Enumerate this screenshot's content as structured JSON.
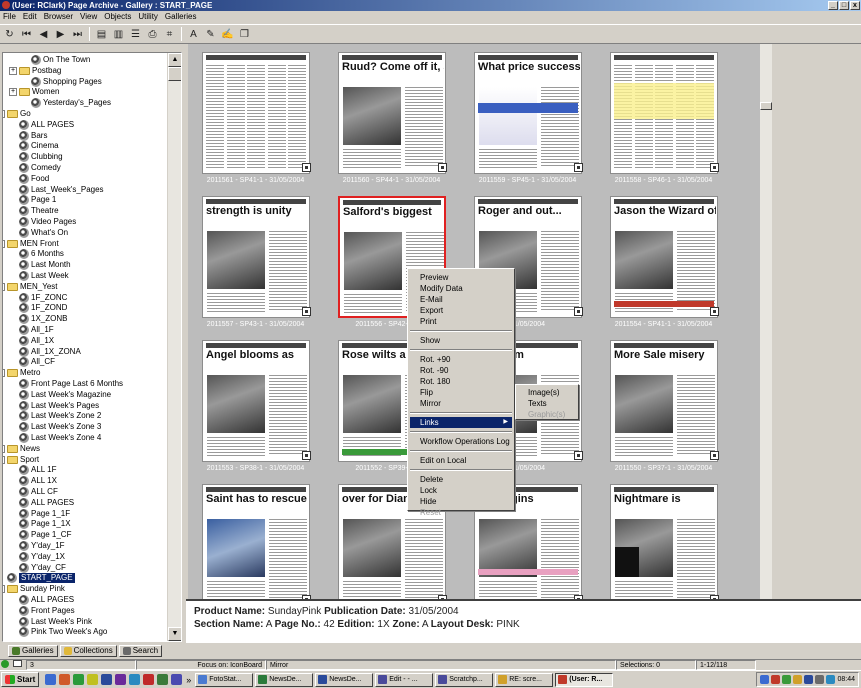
{
  "window": {
    "title": "(User: RClark) Page Archive - Gallery : START_PAGE",
    "buttons": [
      "_",
      "□",
      "x"
    ]
  },
  "menubar": [
    "File",
    "Edit",
    "Browser",
    "View",
    "Objects",
    "Utility",
    "Galleries"
  ],
  "toolbar": {
    "buttons": [
      {
        "icon": "refresh-icon",
        "glyph": "↻"
      },
      {
        "icon": "first-page-icon",
        "glyph": "⏮"
      },
      {
        "icon": "previous-icon",
        "glyph": "◀"
      },
      {
        "icon": "next-icon",
        "glyph": "▶"
      },
      {
        "icon": "last-page-icon",
        "glyph": "⏭"
      },
      {
        "icon": "preview-icon",
        "glyph": "▤"
      },
      {
        "icon": "document-icon",
        "glyph": "▥"
      },
      {
        "icon": "list-icon",
        "glyph": "☰"
      },
      {
        "icon": "print-icon",
        "glyph": "⎙"
      },
      {
        "icon": "binoculars-icon",
        "glyph": "⌗"
      },
      {
        "icon": "font-icon",
        "glyph": "A"
      },
      {
        "icon": "pen-icon",
        "glyph": "✎"
      },
      {
        "icon": "paint-icon",
        "glyph": "✍"
      },
      {
        "icon": "copy-icon",
        "glyph": "❐"
      }
    ]
  },
  "tree": [
    {
      "label": "On The Town",
      "level": 3,
      "type": "gallery"
    },
    {
      "label": "Postbag",
      "level": 2,
      "type": "folder",
      "expander": "+"
    },
    {
      "label": "Shopping Pages",
      "level": 3,
      "type": "gallery"
    },
    {
      "label": "Women",
      "level": 2,
      "type": "folder",
      "expander": "+"
    },
    {
      "label": "Yesterday's_Pages",
      "level": 3,
      "type": "gallery"
    },
    {
      "label": "Go",
      "level": 1,
      "type": "folder",
      "expander": "-"
    },
    {
      "label": "ALL PAGES",
      "level": 2,
      "type": "gallery"
    },
    {
      "label": "Bars",
      "level": 2,
      "type": "gallery"
    },
    {
      "label": "Cinema",
      "level": 2,
      "type": "gallery"
    },
    {
      "label": "Clubbing",
      "level": 2,
      "type": "gallery"
    },
    {
      "label": "Comedy",
      "level": 2,
      "type": "gallery"
    },
    {
      "label": "Food",
      "level": 2,
      "type": "gallery"
    },
    {
      "label": "Last_Week's_Pages",
      "level": 2,
      "type": "gallery"
    },
    {
      "label": "Page 1",
      "level": 2,
      "type": "gallery"
    },
    {
      "label": "Theatre",
      "level": 2,
      "type": "gallery"
    },
    {
      "label": "Video Pages",
      "level": 2,
      "type": "gallery"
    },
    {
      "label": "What's On",
      "level": 2,
      "type": "gallery"
    },
    {
      "label": "MEN Front",
      "level": 1,
      "type": "folder",
      "expander": "-"
    },
    {
      "label": "6 Months",
      "level": 2,
      "type": "gallery"
    },
    {
      "label": "Last Month",
      "level": 2,
      "type": "gallery"
    },
    {
      "label": "Last Week",
      "level": 2,
      "type": "gallery"
    },
    {
      "label": "MEN_Yest",
      "level": 1,
      "type": "folder",
      "expander": "-"
    },
    {
      "label": "1F_ZONC",
      "level": 2,
      "type": "gallery"
    },
    {
      "label": "1F_ZOND",
      "level": 2,
      "type": "gallery"
    },
    {
      "label": "1X_ZONB",
      "level": 2,
      "type": "gallery"
    },
    {
      "label": "All_1F",
      "level": 2,
      "type": "gallery"
    },
    {
      "label": "All_1X",
      "level": 2,
      "type": "gallery"
    },
    {
      "label": "All_1X_ZONA",
      "level": 2,
      "type": "gallery"
    },
    {
      "label": "All_CF",
      "level": 2,
      "type": "gallery"
    },
    {
      "label": "Metro",
      "level": 1,
      "type": "folder",
      "expander": "-"
    },
    {
      "label": "Front Page Last 6 Months",
      "level": 2,
      "type": "gallery"
    },
    {
      "label": "Last Week's Magazine",
      "level": 2,
      "type": "gallery"
    },
    {
      "label": "Last Week's Pages",
      "level": 2,
      "type": "gallery"
    },
    {
      "label": "Last Week's Zone 2",
      "level": 2,
      "type": "gallery"
    },
    {
      "label": "Last Week's Zone 3",
      "level": 2,
      "type": "gallery"
    },
    {
      "label": "Last Week's Zone 4",
      "level": 2,
      "type": "gallery"
    },
    {
      "label": "News",
      "level": 1,
      "type": "folder",
      "expander": "+"
    },
    {
      "label": "Sport",
      "level": 1,
      "type": "folder",
      "expander": "-"
    },
    {
      "label": "ALL 1F",
      "level": 2,
      "type": "gallery"
    },
    {
      "label": "ALL 1X",
      "level": 2,
      "type": "gallery"
    },
    {
      "label": "ALL CF",
      "level": 2,
      "type": "gallery"
    },
    {
      "label": "ALL PAGES",
      "level": 2,
      "type": "gallery"
    },
    {
      "label": "Page 1_1F",
      "level": 2,
      "type": "gallery"
    },
    {
      "label": "Page 1_1X",
      "level": 2,
      "type": "gallery"
    },
    {
      "label": "Page 1_CF",
      "level": 2,
      "type": "gallery"
    },
    {
      "label": "Y'day_1F",
      "level": 2,
      "type": "gallery"
    },
    {
      "label": "Y'day_1X",
      "level": 2,
      "type": "gallery"
    },
    {
      "label": "Y'day_CF",
      "level": 2,
      "type": "gallery"
    },
    {
      "label": "START_PAGE",
      "level": 1,
      "type": "gallery",
      "selected": true
    },
    {
      "label": "Sunday Pink",
      "level": 1,
      "type": "folder",
      "expander": "-"
    },
    {
      "label": "ALL PAGES",
      "level": 2,
      "type": "gallery"
    },
    {
      "label": "Front Pages",
      "level": 2,
      "type": "gallery"
    },
    {
      "label": "Last Week's Pink",
      "level": 2,
      "type": "gallery"
    },
    {
      "label": "Pink Two Week's Ago",
      "level": 2,
      "type": "gallery"
    }
  ],
  "tree_scroll": {
    "up": "▲",
    "down": "▼"
  },
  "left_tabs": [
    {
      "label": "Galleries",
      "icon": "galleries-icon",
      "color": "#4a7a2a"
    },
    {
      "label": "Collections",
      "icon": "collections-icon",
      "color": "#e0b83a"
    },
    {
      "label": "Search",
      "icon": "search-icon",
      "color": "#6a6a6a"
    }
  ],
  "thumbnails": [
    {
      "caption": "2011561 - SP41-1 - 31/05/2004",
      "headline": "",
      "style": "text"
    },
    {
      "caption": "2011560 - SP44-1 - 31/05/2004",
      "headline": "Ruud? Come off it, Sven!",
      "style": "photo"
    },
    {
      "caption": "2011559 - SP45-1 - 31/05/2004",
      "headline": "What price success?",
      "style": "travel"
    },
    {
      "caption": "2011558 - SP46-1 - 31/05/2004",
      "headline": "",
      "style": "text-yellow"
    },
    {
      "caption": "2011557 - SP43-1 - 31/05/2004",
      "headline": "strength is unity",
      "style": "photo"
    },
    {
      "caption": "2011556 - SP42-1 - 31/",
      "headline": "Salford's biggest",
      "style": "photo",
      "active": true
    },
    {
      "caption": "31/05/2004",
      "headline": "Roger and out...",
      "style": "photo"
    },
    {
      "caption": "2011554 - SP41-1 - 31/05/2004",
      "headline": "Jason the Wizard of Oz again",
      "style": "photo-red"
    },
    {
      "caption": "2011553 - SP38-1 - 31/05/2004",
      "headline": "Angel blooms as",
      "style": "photo"
    },
    {
      "caption": "2011552 - SP39-1 - 31/",
      "headline": "Rose wilts a",
      "style": "photo-green"
    },
    {
      "caption": "31/05/2004",
      "headline": "ig dream",
      "style": "photo"
    },
    {
      "caption": "2011550 - SP37-1 - 31/05/2004",
      "headline": "More Sale misery",
      "style": "photo"
    },
    {
      "caption": "",
      "headline": "Saint has to rescue the family",
      "style": "photo-blue"
    },
    {
      "caption": "",
      "headline": "over for Diane",
      "style": "photo"
    },
    {
      "caption": "",
      "headline": "gold ggins",
      "style": "photo-pink"
    },
    {
      "caption": "",
      "headline": "Nightmare is",
      "style": "photo-dublin"
    }
  ],
  "context_menu": {
    "items": [
      {
        "label": "Preview"
      },
      {
        "label": "Modify Data"
      },
      {
        "label": "E-Mail"
      },
      {
        "label": "Export"
      },
      {
        "label": "Print"
      },
      {
        "sep": true
      },
      {
        "label": "Show"
      },
      {
        "sep": true
      },
      {
        "label": "Rot. +90"
      },
      {
        "label": "Rot. -90"
      },
      {
        "label": "Rot. 180"
      },
      {
        "label": "Flip"
      },
      {
        "label": "Mirror"
      },
      {
        "sep": true
      },
      {
        "label": "Links",
        "submenu": true,
        "highlight": true,
        "arrow": "▶"
      },
      {
        "sep": true
      },
      {
        "label": "Workflow Operations Log"
      },
      {
        "sep": true
      },
      {
        "label": "Edit on Local"
      },
      {
        "sep": true
      },
      {
        "label": "Delete"
      },
      {
        "label": "Lock"
      },
      {
        "label": "Hide"
      },
      {
        "label": "Reset",
        "disabled": true
      }
    ],
    "submenu": [
      {
        "label": "Image(s)"
      },
      {
        "label": "Texts"
      },
      {
        "label": "Graphic(s)",
        "disabled": true
      }
    ]
  },
  "info": {
    "product_label": "Product Name:",
    "product": "SundayPink",
    "pubdate_label": "Publication Date:",
    "pubdate": "31/05/2004",
    "section_label": "Section Name:",
    "section": "A",
    "page_label": "Page No.:",
    "page": "42",
    "edition_label": "Edition:",
    "edition": "1X",
    "zone_label": "Zone:",
    "zone": "A",
    "desk_label": "Layout Desk:",
    "desk": "PINK"
  },
  "status": {
    "count": "3",
    "focus": "Focus on: IconBoard",
    "action": "Mirror",
    "selections": "Selections: 0",
    "range": "1-12/118"
  },
  "taskbar": {
    "start": "Start",
    "quicklaunch": [
      {
        "icon": "quicklaunch-icon-1",
        "color": "#3a6ad0"
      },
      {
        "icon": "quicklaunch-icon-2",
        "color": "#d05a2a"
      },
      {
        "icon": "quicklaunch-icon-3",
        "color": "#2a9a3a"
      },
      {
        "icon": "quicklaunch-icon-4",
        "color": "#c0c020"
      },
      {
        "icon": "quicklaunch-icon-5",
        "color": "#2a4a9a"
      },
      {
        "icon": "quicklaunch-icon-6",
        "color": "#6a2a9a"
      },
      {
        "icon": "quicklaunch-icon-7",
        "color": "#2a8ac0"
      },
      {
        "icon": "quicklaunch-icon-8",
        "color": "#c02a2a"
      },
      {
        "icon": "quicklaunch-icon-9",
        "color": "#3a7a3a"
      },
      {
        "icon": "quicklaunch-icon-10",
        "color": "#4a4ab0"
      }
    ],
    "chevron": "»",
    "tasks": [
      {
        "label": "FotoStat...",
        "icon": "fotostat-icon",
        "color": "#4a7ad0"
      },
      {
        "label": "NewsDe...",
        "icon": "newsdesk-icon",
        "color": "#2a7a3a"
      },
      {
        "label": "NewsDe...",
        "icon": "newsdesk-icon",
        "color": "#2a4a9a"
      },
      {
        "label": "Edit - - ...",
        "icon": "edit-icon",
        "color": "#4a4a9a"
      },
      {
        "label": "Scratchp...",
        "icon": "scratchpad-icon",
        "color": "#4a4a9a"
      },
      {
        "label": "RE: scre...",
        "icon": "mail-icon",
        "color": "#d0a02a"
      },
      {
        "label": "(User: R...",
        "icon": "archive-icon",
        "color": "#c03a2a",
        "active": true
      }
    ],
    "tray": [
      {
        "icon": "tray-icon-1",
        "color": "#3a6ad0"
      },
      {
        "icon": "tray-icon-2",
        "color": "#c03a2a"
      },
      {
        "icon": "tray-icon-3",
        "color": "#3a9a3a"
      },
      {
        "icon": "tray-icon-4",
        "color": "#d0a02a"
      },
      {
        "icon": "tray-icon-5",
        "color": "#2a4a9a"
      },
      {
        "icon": "tray-icon-6",
        "color": "#6a6a6a"
      },
      {
        "icon": "tray-icon-7",
        "color": "#2a8ac0"
      }
    ],
    "clock": "08:44"
  }
}
